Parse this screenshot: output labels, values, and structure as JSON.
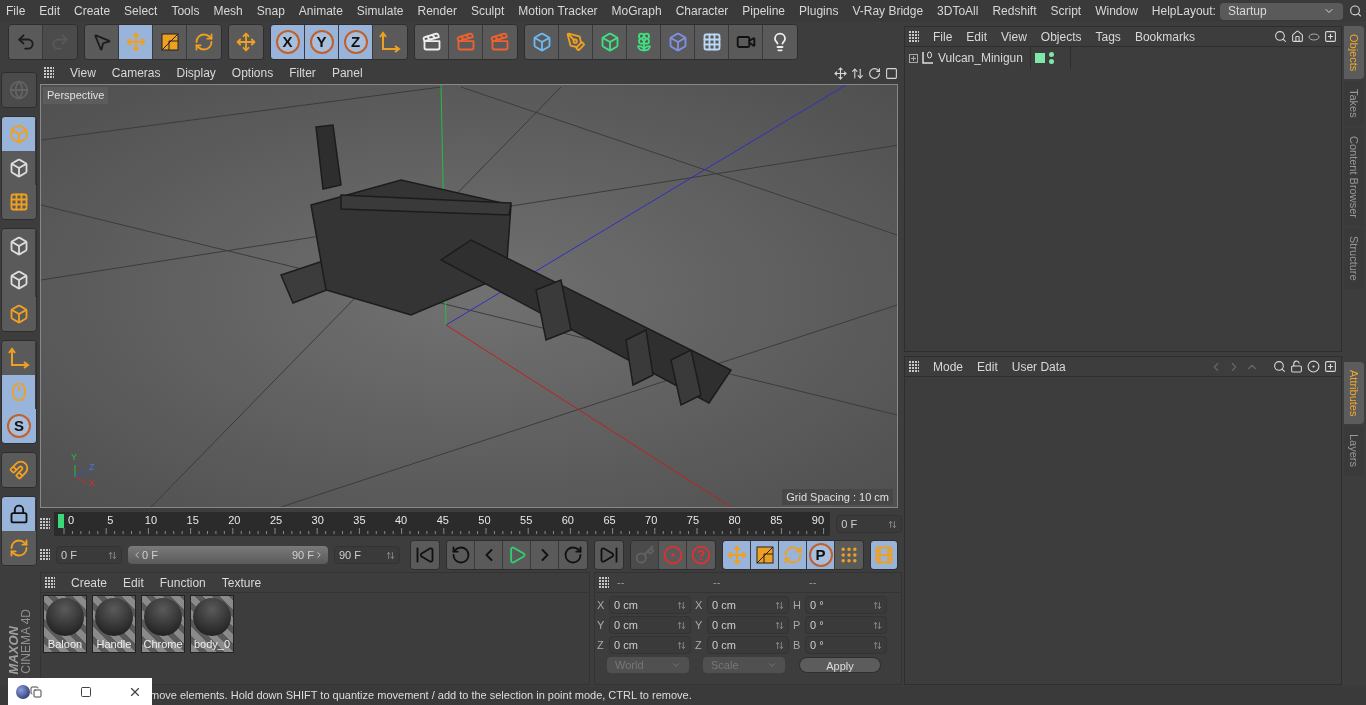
{
  "menu_bar": {
    "items": [
      "File",
      "Edit",
      "Create",
      "Select",
      "Tools",
      "Mesh",
      "Snap",
      "Animate",
      "Simulate",
      "Render",
      "Sculpt",
      "Motion Tracker",
      "MoGraph",
      "Character",
      "Pipeline",
      "Plugins",
      "V-Ray Bridge",
      "3DToAll",
      "Redshift",
      "Script",
      "Window",
      "Help"
    ],
    "layout_label": "Layout:",
    "layout_value": "Startup"
  },
  "toolbar": {
    "groups": [
      {
        "buttons": [
          {
            "kind": "undo",
            "selected": false,
            "disabled": false
          },
          {
            "kind": "redo",
            "selected": false,
            "disabled": true
          }
        ]
      },
      {
        "buttons": [
          {
            "kind": "select",
            "selected": false
          },
          {
            "kind": "move",
            "selected": true
          },
          {
            "kind": "scale",
            "selected": false
          },
          {
            "kind": "rotate",
            "selected": false
          }
        ]
      },
      {
        "buttons": [
          {
            "kind": "move",
            "selected": false
          }
        ]
      },
      {
        "buttons": [
          {
            "kind": "axis",
            "label": "X",
            "selected": true
          },
          {
            "kind": "axis",
            "label": "Y",
            "selected": true
          },
          {
            "kind": "axis",
            "label": "Z",
            "selected": true
          },
          {
            "kind": "coordinates",
            "selected": false
          }
        ]
      },
      {
        "buttons": [
          {
            "kind": "render-view",
            "selected": false
          },
          {
            "kind": "render",
            "selected": false
          },
          {
            "kind": "render-settings",
            "selected": false
          }
        ]
      },
      {
        "buttons": [
          {
            "kind": "cube",
            "selected": false
          },
          {
            "kind": "pen",
            "selected": false
          },
          {
            "kind": "subdivision",
            "selected": false
          },
          {
            "kind": "cloner",
            "selected": false
          },
          {
            "kind": "deformer",
            "selected": false
          },
          {
            "kind": "floor",
            "selected": false
          },
          {
            "kind": "camera",
            "selected": false
          },
          {
            "kind": "light",
            "selected": false
          }
        ]
      }
    ]
  },
  "left_toolbar": {
    "groups": [
      {
        "buttons": [
          {
            "kind": "globe",
            "selected": false,
            "disabled": true
          }
        ]
      },
      {
        "buttons": [
          {
            "kind": "model",
            "selected": true
          },
          {
            "kind": "texture",
            "selected": false
          },
          {
            "kind": "workplane",
            "selected": false
          }
        ]
      },
      {
        "buttons": [
          {
            "kind": "points",
            "selected": false
          },
          {
            "kind": "edges",
            "selected": false
          },
          {
            "kind": "polygons",
            "selected": false
          }
        ]
      },
      {
        "buttons": [
          {
            "kind": "axes",
            "selected": false
          },
          {
            "kind": "tweak",
            "selected": true
          },
          {
            "kind": "solo",
            "label": "S",
            "selected": true
          }
        ]
      },
      {
        "buttons": [
          {
            "kind": "magnet",
            "selected": false
          }
        ]
      },
      {
        "buttons": [
          {
            "kind": "lock-grid",
            "selected": true
          },
          {
            "kind": "grid-refresh",
            "selected": false
          }
        ]
      }
    ]
  },
  "logo": {
    "brand": "MAXON",
    "product": "CINEMA 4D"
  },
  "viewport": {
    "menu": [
      "View",
      "Cameras",
      "Display",
      "Options",
      "Filter",
      "Panel"
    ],
    "camera_label": "Perspective",
    "grid_spacing": "Grid Spacing : 10 cm",
    "gizmo_labels": [
      "Y",
      "Z",
      "X"
    ]
  },
  "timeline": {
    "ticks": [
      "0",
      "5",
      "10",
      "15",
      "20",
      "25",
      "30",
      "35",
      "40",
      "45",
      "50",
      "55",
      "60",
      "65",
      "70",
      "75",
      "80",
      "85",
      "90"
    ],
    "level": 0,
    "current_field": "0 F"
  },
  "transport": {
    "start_field": "0 F",
    "range": {
      "start": "0 F",
      "end": "90 F",
      "level": 1
    },
    "end_field": "90 F",
    "playback": [
      {
        "kind": "go-start",
        "selected": false
      },
      {
        "kind": "prev-key",
        "selected": false
      },
      {
        "kind": "prev-frame",
        "selected": false
      },
      {
        "kind": "play",
        "selected": false
      },
      {
        "kind": "next-frame",
        "selected": false
      },
      {
        "kind": "next-key",
        "selected": false
      },
      {
        "kind": "go-end",
        "selected": false
      }
    ],
    "record": [
      {
        "kind": "key",
        "disabled": true
      },
      {
        "kind": "record",
        "disabled": false
      },
      {
        "kind": "autokey",
        "disabled": false
      }
    ],
    "keys": [
      {
        "kind": "move",
        "selected": true
      },
      {
        "kind": "scale",
        "selected": true
      },
      {
        "kind": "rotate",
        "selected": true
      },
      {
        "kind": "param",
        "label": "P",
        "selected": true
      },
      {
        "kind": "dots",
        "selected": false
      }
    ],
    "timeline_button": {
      "kind": "film",
      "selected": true
    }
  },
  "materials": {
    "menu": [
      "Create",
      "Edit",
      "Function",
      "Texture"
    ],
    "items": [
      "Baloon",
      "Handle",
      "Chrome",
      "body_0"
    ]
  },
  "coordinates": {
    "headers": [
      "--",
      "--",
      "--"
    ],
    "columns": [
      {
        "rows": [
          {
            "label": "X",
            "value": "0 cm"
          },
          {
            "label": "Y",
            "value": "0 cm"
          },
          {
            "label": "Z",
            "value": "0 cm"
          }
        ]
      },
      {
        "rows": [
          {
            "label": "X",
            "value": "0 cm"
          },
          {
            "label": "Y",
            "value": "0 cm"
          },
          {
            "label": "Z",
            "value": "0 cm"
          }
        ]
      },
      {
        "rows": [
          {
            "label": "H",
            "value": "0 °"
          },
          {
            "label": "P",
            "value": "0 °"
          },
          {
            "label": "B",
            "value": "0 °"
          }
        ]
      }
    ],
    "dropdowns": [
      {
        "value": "World",
        "disabled": true
      },
      {
        "value": "Scale",
        "disabled": true
      }
    ],
    "apply": "Apply"
  },
  "objects": {
    "menu": [
      "File",
      "Edit",
      "View",
      "Objects",
      "Tags",
      "Bookmarks"
    ],
    "rows": [
      {
        "name": "Vulcan_Minigun",
        "expanded": false,
        "visible_editor": true,
        "visible_render": true
      }
    ]
  },
  "attributes": {
    "menu": [
      "Mode",
      "Edit",
      "User Data"
    ],
    "nav": [
      {
        "kind": "back",
        "disabled": true
      },
      {
        "kind": "forward",
        "disabled": true
      },
      {
        "kind": "up",
        "disabled": true
      }
    ]
  },
  "side_tabs_top": [
    {
      "label": "Objects",
      "selected": true
    },
    {
      "label": "Takes",
      "selected": false
    },
    {
      "label": "Content Browser",
      "selected": false
    },
    {
      "label": "Structure",
      "selected": false
    }
  ],
  "side_tabs_bottom": [
    {
      "label": "Attributes",
      "selected": true
    },
    {
      "label": "Layers",
      "selected": false
    }
  ],
  "status_bar": {
    "text": "move elements. Hold down SHIFT to quantize movement / add to the selection in point mode, CTRL to remove."
  }
}
